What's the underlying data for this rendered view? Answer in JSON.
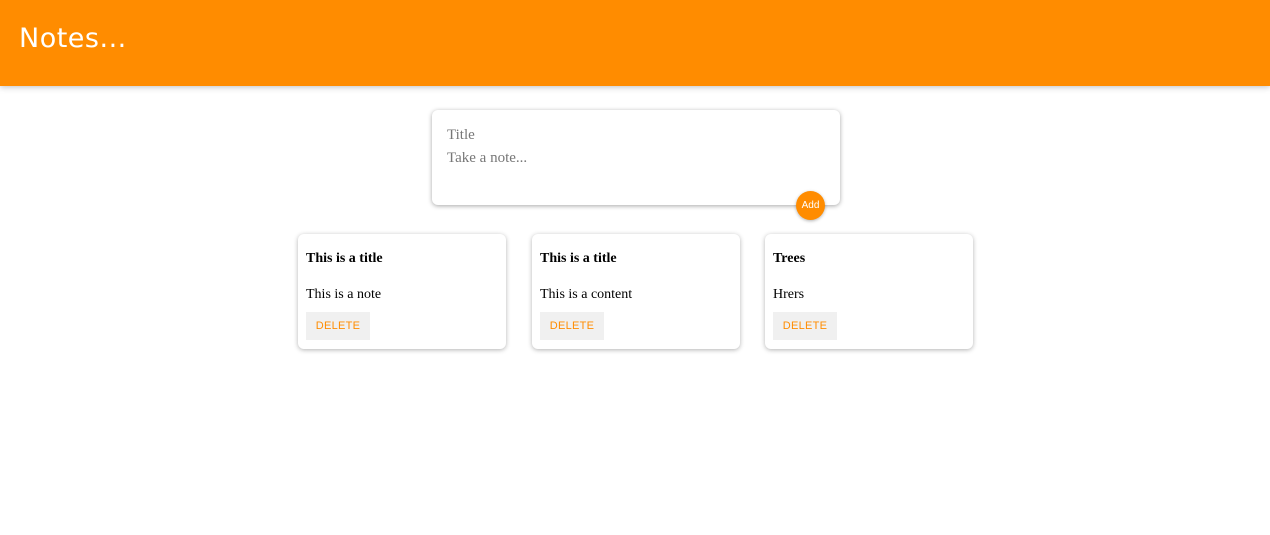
{
  "header": {
    "title": "Notes..."
  },
  "create_note": {
    "title_placeholder": "Title",
    "content_placeholder": "Take a note...",
    "add_label": "Add"
  },
  "notes": [
    {
      "title": "This is a title",
      "content": "This is a note",
      "delete_label": "DELETE"
    },
    {
      "title": "This is a title",
      "content": "This is a content",
      "delete_label": "DELETE"
    },
    {
      "title": "Trees",
      "content": "Hrers",
      "delete_label": "DELETE"
    }
  ],
  "colors": {
    "accent": "#ff8c00",
    "button_bg": "#f0f0f0"
  }
}
